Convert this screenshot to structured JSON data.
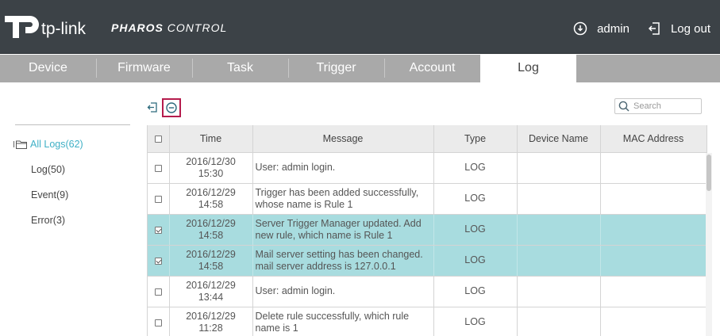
{
  "header": {
    "brand": "tp-link",
    "product_bold": "PHAROS",
    "product_light": "CONTROL",
    "user_label": "admin",
    "logout_label": "Log out",
    "user_icon": "user-circle-icon",
    "logout_icon": "logout-icon"
  },
  "tabs": [
    {
      "label": "Device",
      "active": false
    },
    {
      "label": "Firmware",
      "active": false
    },
    {
      "label": "Task",
      "active": false
    },
    {
      "label": "Trigger",
      "active": false
    },
    {
      "label": "Account",
      "active": false
    },
    {
      "label": "Log",
      "active": true
    }
  ],
  "sidebar": {
    "root": {
      "label": "All Logs(62)",
      "icon": "folder-icon"
    },
    "items": [
      {
        "label": "Log(50)"
      },
      {
        "label": "Event(9)"
      },
      {
        "label": "Error(3)"
      }
    ]
  },
  "toolbar": {
    "export_icon": "export-icon",
    "delete_icon": "delete-circle-icon",
    "search_placeholder": "Search"
  },
  "table": {
    "columns": [
      "Time",
      "Message",
      "Type",
      "Device Name",
      "MAC Address"
    ],
    "rows": [
      {
        "date": "2016/12/30",
        "clock": "15:30",
        "message": "User: admin login.",
        "type": "LOG",
        "device": "",
        "mac": "",
        "checked": false
      },
      {
        "date": "2016/12/29",
        "clock": "14:58",
        "message": "Trigger has been added successfully, whose name is Rule 1",
        "type": "LOG",
        "device": "",
        "mac": "",
        "checked": false
      },
      {
        "date": "2016/12/29",
        "clock": "14:58",
        "message": "Server Trigger Manager updated. Add new rule, which name is Rule 1",
        "type": "LOG",
        "device": "",
        "mac": "",
        "checked": true
      },
      {
        "date": "2016/12/29",
        "clock": "14:58",
        "message": "Mail server setting has been changed. mail server address is 127.0.0.1",
        "type": "LOG",
        "device": "",
        "mac": "",
        "checked": true
      },
      {
        "date": "2016/12/29",
        "clock": "13:44",
        "message": "User: admin login.",
        "type": "LOG",
        "device": "",
        "mac": "",
        "checked": false
      },
      {
        "date": "2016/12/29",
        "clock": "11:28",
        "message": "Delete rule successfully, which rule name is 1",
        "type": "LOG",
        "device": "",
        "mac": "",
        "checked": false
      }
    ]
  },
  "colors": {
    "header_bg": "#3c4247",
    "tab_bar": "#a9a9a9",
    "accent": "#3fb0c6",
    "selected_row": "#a8dcdf",
    "delete_highlight": "#b51c4d"
  }
}
